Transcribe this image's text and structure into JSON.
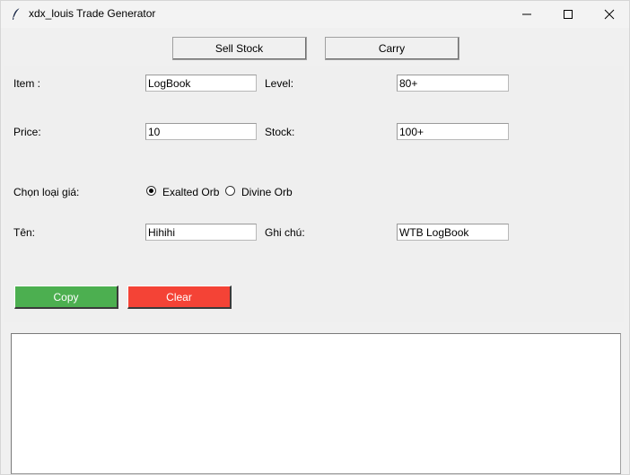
{
  "window": {
    "title": "xdx_louis Trade Generator",
    "icons": {
      "app": "feather-icon",
      "minimize": "minimize-icon",
      "maximize": "maximize-icon",
      "close": "close-icon"
    }
  },
  "top_buttons": {
    "sell_stock": "Sell Stock",
    "carry": "Carry"
  },
  "form": {
    "item_label": "Item :",
    "item_value": "LogBook",
    "level_label": "Level:",
    "level_value": "80+",
    "price_label": "Price:",
    "price_value": "10",
    "stock_label": "Stock:",
    "stock_value": "100+",
    "price_type_label": "Chọn loại giá:",
    "price_type_options": [
      "Exalted Orb",
      "Divine Orb"
    ],
    "price_type_selected": "Exalted Orb",
    "name_label": "Tên:",
    "name_value": "Hihihi",
    "note_label": "Ghi chú:",
    "note_value": "WTB LogBook"
  },
  "actions": {
    "copy": "Copy",
    "clear": "Clear",
    "copy_color": "#4caf50",
    "clear_color": "#f44336"
  },
  "output": {
    "text": ""
  }
}
